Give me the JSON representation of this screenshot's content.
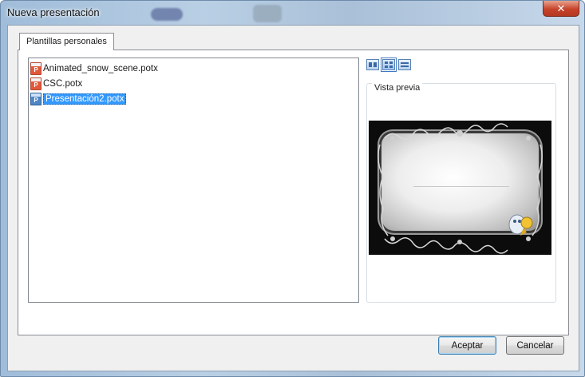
{
  "window": {
    "title": "Nueva presentación",
    "close_glyph": "✕"
  },
  "tabs": [
    {
      "label": "Plantillas personales",
      "active": true
    }
  ],
  "file_list": {
    "items": [
      {
        "name": "Animated_snow_scene.potx",
        "icon": "powerpoint-template-icon",
        "selected": false
      },
      {
        "name": "CSC.potx",
        "icon": "powerpoint-template-icon",
        "selected": false
      },
      {
        "name": "Presentación2.potx",
        "icon": "powerpoint-template-icon",
        "selected": true
      }
    ]
  },
  "view_buttons": [
    {
      "icon": "large-icons-view-icon",
      "active": false
    },
    {
      "icon": "list-view-icon",
      "active": true
    },
    {
      "icon": "details-view-icon",
      "active": false
    }
  ],
  "preview": {
    "caption": "Vista previa"
  },
  "buttons": {
    "accept": "Aceptar",
    "cancel": "Cancelar"
  },
  "colors": {
    "selection": "#3399ff",
    "close_button": "#c7432a",
    "frame": "#b9cfe4"
  }
}
